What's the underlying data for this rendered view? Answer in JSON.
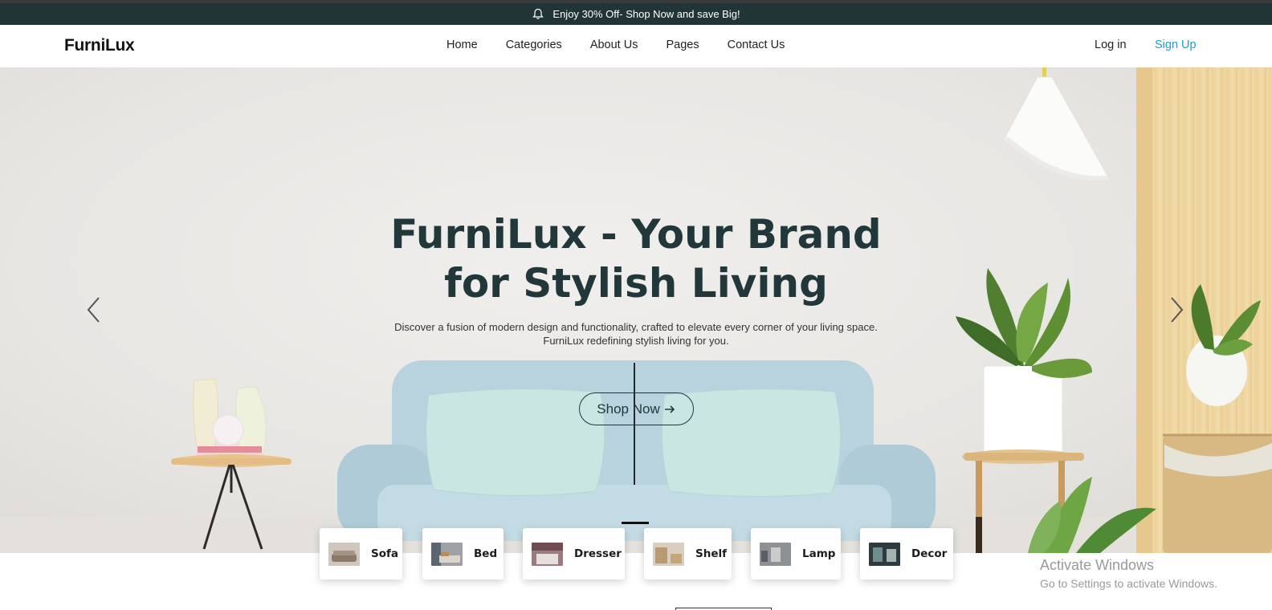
{
  "promo": {
    "text": "Enjoy 30% Off- Shop Now and save Big!",
    "icon": "bell-icon"
  },
  "nav": {
    "brand": "FurniLux",
    "links": [
      "Home",
      "Categories",
      "About Us",
      "Pages",
      "Contact Us"
    ],
    "login": "Log in",
    "signup": "Sign Up"
  },
  "hero": {
    "title_line1": "FurniLux - Your Brand",
    "title_line2": "for Stylish Living",
    "subtitle_line1": "Discover a fusion of modern design and functionality, crafted to elevate every corner of your living space.",
    "subtitle_line2": "FurniLux redefining stylish living for you.",
    "cta": "Shop Now",
    "cta_icon": "arrow-right-icon",
    "prev_icon": "chevron-left-icon",
    "next_icon": "chevron-right-icon"
  },
  "categories": [
    "Sofa",
    "Bed",
    "Dresser",
    "Shelf",
    "Lamp",
    "Decor"
  ],
  "watermark": {
    "title": "Activate Windows",
    "subtitle": "Go to Settings to activate Windows."
  },
  "colors": {
    "promo_bg": "#223536",
    "heading": "#22373a",
    "signup": "#1a9fd0",
    "sofa": "#b9d3de",
    "cushion": "#c9e6e2"
  }
}
